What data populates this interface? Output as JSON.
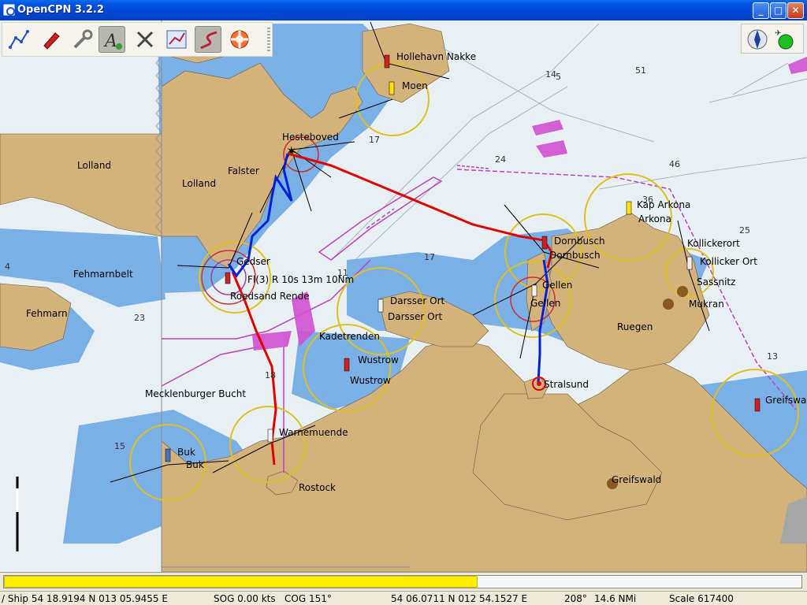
{
  "window": {
    "title": "OpenCPN 3.2.2",
    "minimize": "_",
    "maximize": "□",
    "close": "✕"
  },
  "toolbar": {
    "tools": [
      {
        "name": "route",
        "icon": "route-icon"
      },
      {
        "name": "ship-follow",
        "icon": "ship-icon"
      },
      {
        "name": "settings",
        "icon": "wrench-icon"
      },
      {
        "name": "text",
        "icon": "text-icon"
      },
      {
        "name": "cursor",
        "icon": "cursor-icon"
      },
      {
        "name": "route-manager",
        "icon": "route-manager-icon"
      },
      {
        "name": "track",
        "icon": "track-icon"
      },
      {
        "name": "mob",
        "icon": "life-ring-icon"
      }
    ]
  },
  "map": {
    "places": {
      "lolland1": "Lolland",
      "lolland2": "Lolland",
      "falster": "Falster",
      "hesteboved": "Hesteboved",
      "hollehavn": "Hollehavn Nakke",
      "moen": "Moen",
      "gedser": "Gedser",
      "light_char": "Fl(3) R 10s 13m 10Nm",
      "roedsand": "Roedsand Rende",
      "fehmarnbelt": "Fehmarnbelt",
      "fehmarn": "Fehmarn",
      "darsser1": "Darsser Ort",
      "darsser2": "Darsser Ort",
      "kadetrenden": "Kadetrenden",
      "wustrow1": "Wustrow",
      "wustrow2": "Wustrow",
      "mecklenburger": "Mecklenburger Bucht",
      "warnemuende": "Warnemuende",
      "rostock": "Rostock",
      "buk1": "Buk",
      "buk2": "Buk",
      "dornbusch1": "Dornbusch",
      "dornbusch2": "Dornbusch",
      "gellen1": "Gellen",
      "gellen2": "Gellen",
      "stralsund": "Stralsund",
      "kap_arkona": "Kap Arkona",
      "arkona": "Arkona",
      "kollickerort1": "Kollickerort",
      "kollickerort2": "Kollicker Ort",
      "sassnitz": "Sassnitz",
      "mukran": "Mukran",
      "ruegen": "Ruegen",
      "greifswald": "Greifswald",
      "greifswa": "Greifswa"
    },
    "depths": [
      "4",
      "23",
      "15",
      "18",
      "11",
      "17",
      "17",
      "24",
      "14",
      "5",
      "51",
      "46",
      "36",
      "25",
      "13"
    ]
  },
  "progress": {
    "fraction": 0.595
  },
  "status": {
    "ship": "/ Ship 54 18.9194 N   013 05.9455 E",
    "sog": "SOG 0.00 kts",
    "cog": "COG 151°",
    "cursor_pos": "54 06.0711 N   012 54.1527 E",
    "bearing": "208°",
    "distance": "14.6 NMi",
    "scale": "Scale 617400"
  },
  "colors": {
    "land": "#d3b37b",
    "shallow": "#7bb0e6",
    "deep": "#e8f0f3",
    "track_red": "#e00000",
    "track_blue": "#0020e0",
    "magenta": "#c040c0",
    "light_ring": "#e0c020"
  }
}
